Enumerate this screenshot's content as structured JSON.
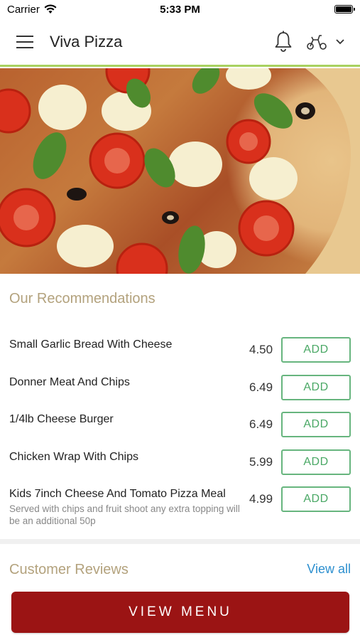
{
  "status_bar": {
    "carrier": "Carrier",
    "time": "5:33 PM"
  },
  "header": {
    "title": "Viva Pizza",
    "icons": {
      "menu": "hamburger-menu-icon",
      "notifications": "bell-icon",
      "delivery": "scooter-icon",
      "dropdown": "chevron-down-icon"
    },
    "accent_color": "#a8d160"
  },
  "hero": {
    "image": "pizza-hero-image"
  },
  "recommendations": {
    "title": "Our Recommendations",
    "items": [
      {
        "name": "Small Garlic Bread With Cheese",
        "description": "",
        "price": "4.50",
        "button": "ADD"
      },
      {
        "name": "Donner Meat And Chips",
        "description": "",
        "price": "6.49",
        "button": "ADD"
      },
      {
        "name": "1/4lb Cheese Burger",
        "description": "",
        "price": "6.49",
        "button": "ADD"
      },
      {
        "name": "Chicken Wrap With Chips",
        "description": "",
        "price": "5.99",
        "button": "ADD"
      },
      {
        "name": "Kids 7inch Cheese And Tomato Pizza Meal",
        "description": "Served with chips and fruit shoot any extra topping will be an additional 50p",
        "price": "4.99",
        "button": "ADD"
      }
    ]
  },
  "reviews": {
    "title": "Customer Reviews",
    "view_all": "View all"
  },
  "footer": {
    "view_menu": "VIEW MENU"
  },
  "colors": {
    "primary": "#9b1414",
    "add_button": "#4aa865",
    "section_title": "#b3a27d",
    "link": "#2c8fcf"
  }
}
